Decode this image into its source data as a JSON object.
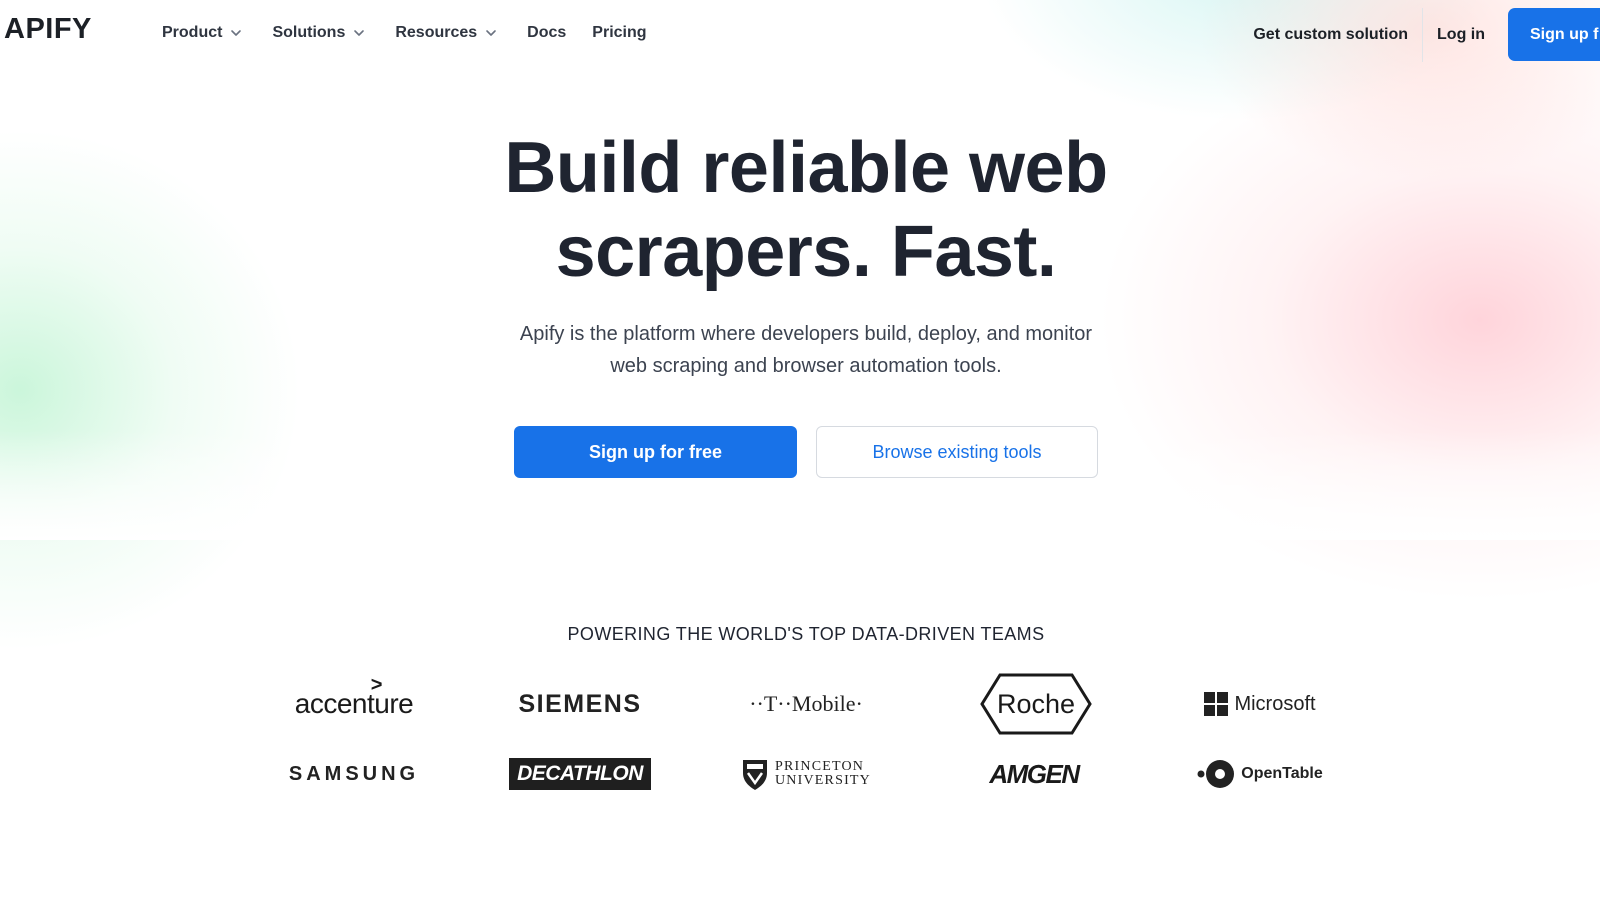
{
  "nav": {
    "logo": "APIFY",
    "menu": [
      {
        "label": "Product",
        "has_dropdown": true
      },
      {
        "label": "Solutions",
        "has_dropdown": true
      },
      {
        "label": "Resources",
        "has_dropdown": true
      },
      {
        "label": "Docs",
        "has_dropdown": false
      },
      {
        "label": "Pricing",
        "has_dropdown": false
      }
    ],
    "custom_solution": "Get custom solution",
    "login": "Log in",
    "signup": "Sign up f"
  },
  "hero": {
    "title_line1": "Build reliable web",
    "title_line2": "scrapers. Fast.",
    "subtitle_line1": "Apify is the platform where developers build, deploy, and monitor",
    "subtitle_line2": "web scraping and browser automation tools.",
    "cta_primary": "Sign up for free",
    "cta_secondary": "Browse existing tools"
  },
  "logos": {
    "heading": "POWERING THE WORLD'S TOP DATA-DRIVEN TEAMS",
    "accenture": "accenture",
    "siemens": "SIEMENS",
    "tmobile": "··T··Mobile·",
    "roche": "Roche",
    "microsoft": "Microsoft",
    "samsung": "SAMSUNG",
    "decathlon": "DECATHLON",
    "princeton_line1": "PRINCETON",
    "princeton_line2": "UNIVERSITY",
    "amgen": "AMGEN",
    "opentable": "OpenTable"
  },
  "colors": {
    "primary": "#1872e8",
    "text_dark": "#1f2430",
    "text_body": "#3c4350",
    "border": "#d6dae0"
  }
}
